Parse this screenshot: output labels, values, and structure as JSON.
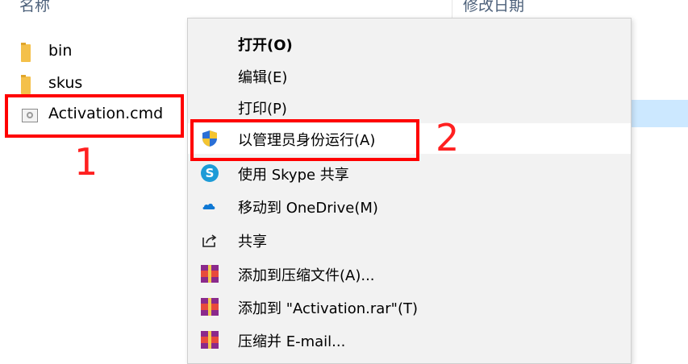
{
  "header": {
    "name_col": "名称",
    "date_col": "修改日期"
  },
  "files": [
    {
      "name": "bin",
      "icon": "folder-icon"
    },
    {
      "name": "skus",
      "icon": "folder-icon"
    },
    {
      "name": "Activation.cmd",
      "icon": "cmd-file-icon"
    }
  ],
  "annotations": {
    "step1": "1",
    "step2": "2",
    "color": "#ff0000"
  },
  "context_menu": {
    "items": [
      {
        "label": "打开(O)"
      },
      {
        "label": "编辑(E)"
      },
      {
        "label": "打印(P)"
      },
      {
        "label": "以管理员身份运行(A)",
        "icon": "uac-shield-icon"
      },
      {
        "label": "使用 Skype 共享",
        "icon": "skype-icon",
        "icon_text": "S"
      },
      {
        "label": "移动到 OneDrive(M)",
        "icon": "onedrive-cloud-icon"
      },
      {
        "label": "共享",
        "icon": "share-icon"
      },
      {
        "label": "添加到压缩文件(A)...",
        "icon": "winrar-icon"
      },
      {
        "label": "添加到 \"Activation.rar\"(T)",
        "icon": "winrar-icon"
      },
      {
        "label": "压缩并 E-mail...",
        "icon": "winrar-icon"
      }
    ]
  },
  "colors": {
    "selection": "#cce8ff",
    "menu_bg": "#f2f2f2",
    "header_text": "#4c607a"
  }
}
